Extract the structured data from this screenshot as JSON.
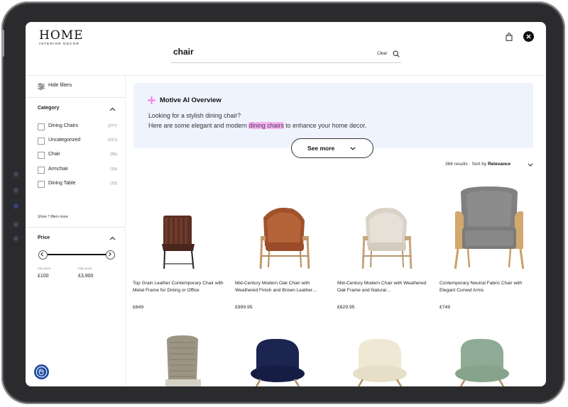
{
  "header": {
    "logo_main": "HOME",
    "logo_sub": "INTERIOR DECOR",
    "search_value": "chair",
    "clear_label": "Clear"
  },
  "sidebar": {
    "hide_filters_label": "Hide filters",
    "category_title": "Category",
    "categories": [
      {
        "label": "Dining Chairs",
        "count": "(277)"
      },
      {
        "label": "Uncategorized",
        "count": "(217)"
      },
      {
        "label": "Chair",
        "count": "(35)"
      },
      {
        "label": "Armchair",
        "count": "(19)"
      },
      {
        "label": "Dining Table",
        "count": "(15)"
      }
    ],
    "show_more_label": "Show 7 filters more",
    "price_title": "Price",
    "min_price_label": "min price",
    "min_price_value": "£100",
    "max_price_label": "max price",
    "max_price_value": "£3,900"
  },
  "ai_overview": {
    "title": "Motive AI Overview",
    "line1": "Looking for a stylish dining chair?",
    "line2_before": "Here are some elegant and modern ",
    "line2_highlight": "dining chairs",
    "line2_after": " to enhance your home decor.",
    "see_more_label": "See more",
    "highlight_color": "#f3b6f1",
    "background_color": "#eff3fd"
  },
  "results": {
    "count_text": "366 results · Sort by",
    "sort_value": "Relevance"
  },
  "products": [
    {
      "title": "Top Grain Leather Contemporary Chair with Metal Frame for Dining or Office",
      "price": "£649"
    },
    {
      "title": "Mid-Century Modern Oak Chair with Weathered Finish and Brown Leather…",
      "price": "£999.95"
    },
    {
      "title": "Mid-Century Modern Chair with Weathered Oak Frame and Natural…",
      "price": "£629.95"
    },
    {
      "title": "Contemporary Neutral Fabric Chair with Elegant Curved Arms",
      "price": "£749"
    }
  ],
  "accent_colors": {
    "accessibility_button": "#1d4aa0",
    "spark": "#f08ee8"
  }
}
